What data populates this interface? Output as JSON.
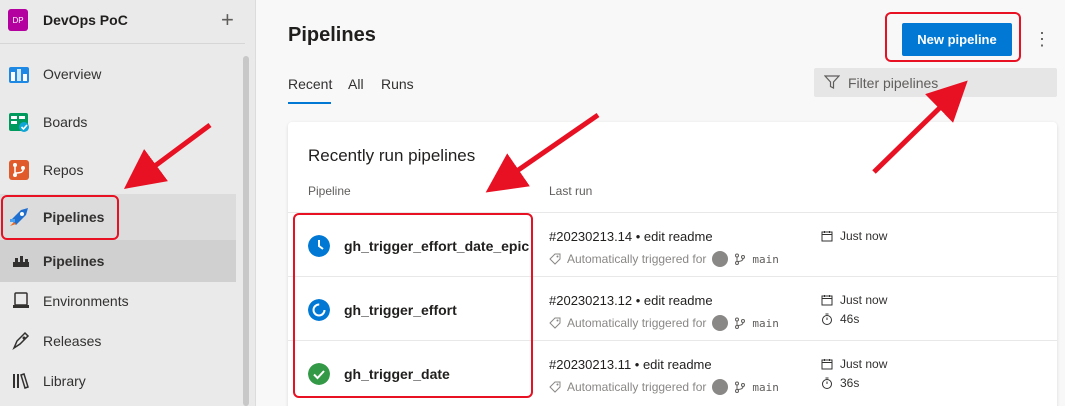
{
  "project": {
    "avatar_initials": "DP",
    "name": "DevOps PoC",
    "add_symbol": "+"
  },
  "sidebar": {
    "items": [
      {
        "label": "Overview",
        "icon": "overview-icon"
      },
      {
        "label": "Boards",
        "icon": "boards-icon"
      },
      {
        "label": "Repos",
        "icon": "repos-icon"
      },
      {
        "label": "Pipelines",
        "icon": "pipelines-icon"
      },
      {
        "label": "Pipelines",
        "icon": "pipelines-sub-icon"
      },
      {
        "label": "Environments",
        "icon": "environments-icon"
      },
      {
        "label": "Releases",
        "icon": "releases-icon"
      },
      {
        "label": "Library",
        "icon": "library-icon"
      }
    ]
  },
  "header": {
    "title": "Pipelines",
    "new_pipeline_label": "New pipeline",
    "more_symbol": "⋮"
  },
  "tabs": [
    {
      "label": "Recent"
    },
    {
      "label": "All"
    },
    {
      "label": "Runs"
    }
  ],
  "filter": {
    "placeholder": "Filter pipelines"
  },
  "card": {
    "title": "Recently run pipelines",
    "col_pipeline": "Pipeline",
    "col_last_run": "Last run",
    "rows": [
      {
        "name": "gh_trigger_effort_date_epic",
        "status": "queued",
        "run": "#20230213.14 • edit readme",
        "trigger": "Automatically triggered for",
        "branch": "main",
        "when": "Just now",
        "duration": ""
      },
      {
        "name": "gh_trigger_effort",
        "status": "running",
        "run": "#20230213.12 • edit readme",
        "trigger": "Automatically triggered for",
        "branch": "main",
        "when": "Just now",
        "duration": "46s"
      },
      {
        "name": "gh_trigger_date",
        "status": "succeeded",
        "run": "#20230213.11 • edit readme",
        "trigger": "Automatically triggered for",
        "branch": "main",
        "when": "Just now",
        "duration": "36s"
      }
    ]
  },
  "colors": {
    "accent": "#0078d4",
    "success": "#339947",
    "annotation": "#e81123",
    "project": "#b4009e"
  }
}
